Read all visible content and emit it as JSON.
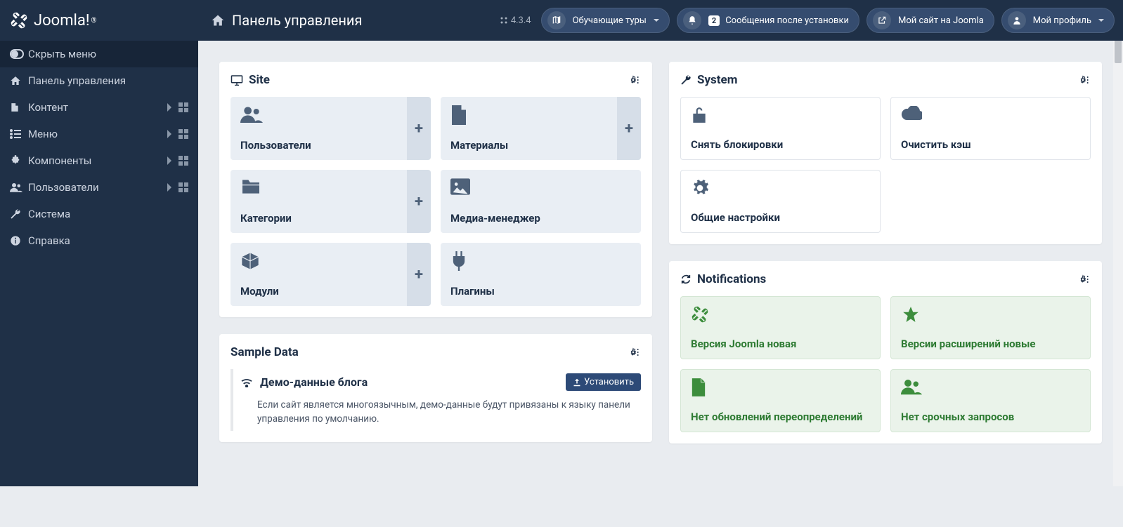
{
  "header": {
    "brand": "Joomla!",
    "page_title": "Панель управления",
    "version": "4.3.4",
    "tours_label": "Обучающие туры",
    "notif_count": "2",
    "notif_label": "Сообщения после установки",
    "site_link": "Мой сайт на Joomla",
    "profile_label": "Мой профиль"
  },
  "sidebar": {
    "toggle": "Скрыть меню",
    "items": [
      {
        "label": "Панель управления",
        "expand": false,
        "grid": false
      },
      {
        "label": "Контент",
        "expand": true,
        "grid": true
      },
      {
        "label": "Меню",
        "expand": true,
        "grid": true
      },
      {
        "label": "Компоненты",
        "expand": true,
        "grid": true
      },
      {
        "label": "Пользователи",
        "expand": true,
        "grid": true
      },
      {
        "label": "Система",
        "expand": false,
        "grid": false
      },
      {
        "label": "Справка",
        "expand": false,
        "grid": false
      }
    ]
  },
  "panels": {
    "site": {
      "title": "Site",
      "items": [
        {
          "label": "Пользователи",
          "plus": true
        },
        {
          "label": "Материалы",
          "plus": true
        },
        {
          "label": "Категории",
          "plus": true
        },
        {
          "label": "Медиа-менеджер",
          "plus": false
        },
        {
          "label": "Модули",
          "plus": true
        },
        {
          "label": "Плагины",
          "plus": false
        }
      ]
    },
    "sample": {
      "title": "Sample Data",
      "item_title": "Демо-данные блога",
      "install": "Установить",
      "desc": "Если сайт является многоязычным, демо-данные будут привязаны к языку панели управления по умолчанию."
    },
    "system": {
      "title": "System",
      "items": [
        {
          "label": "Снять блокировки"
        },
        {
          "label": "Очистить кэш"
        },
        {
          "label": "Общие настройки"
        }
      ]
    },
    "notifications": {
      "title": "Notifications",
      "items": [
        {
          "label": "Версия Joomla новая"
        },
        {
          "label": "Версии расширений новые"
        },
        {
          "label": "Нет обновлений переопределений"
        },
        {
          "label": "Нет срочных запросов"
        }
      ]
    }
  }
}
